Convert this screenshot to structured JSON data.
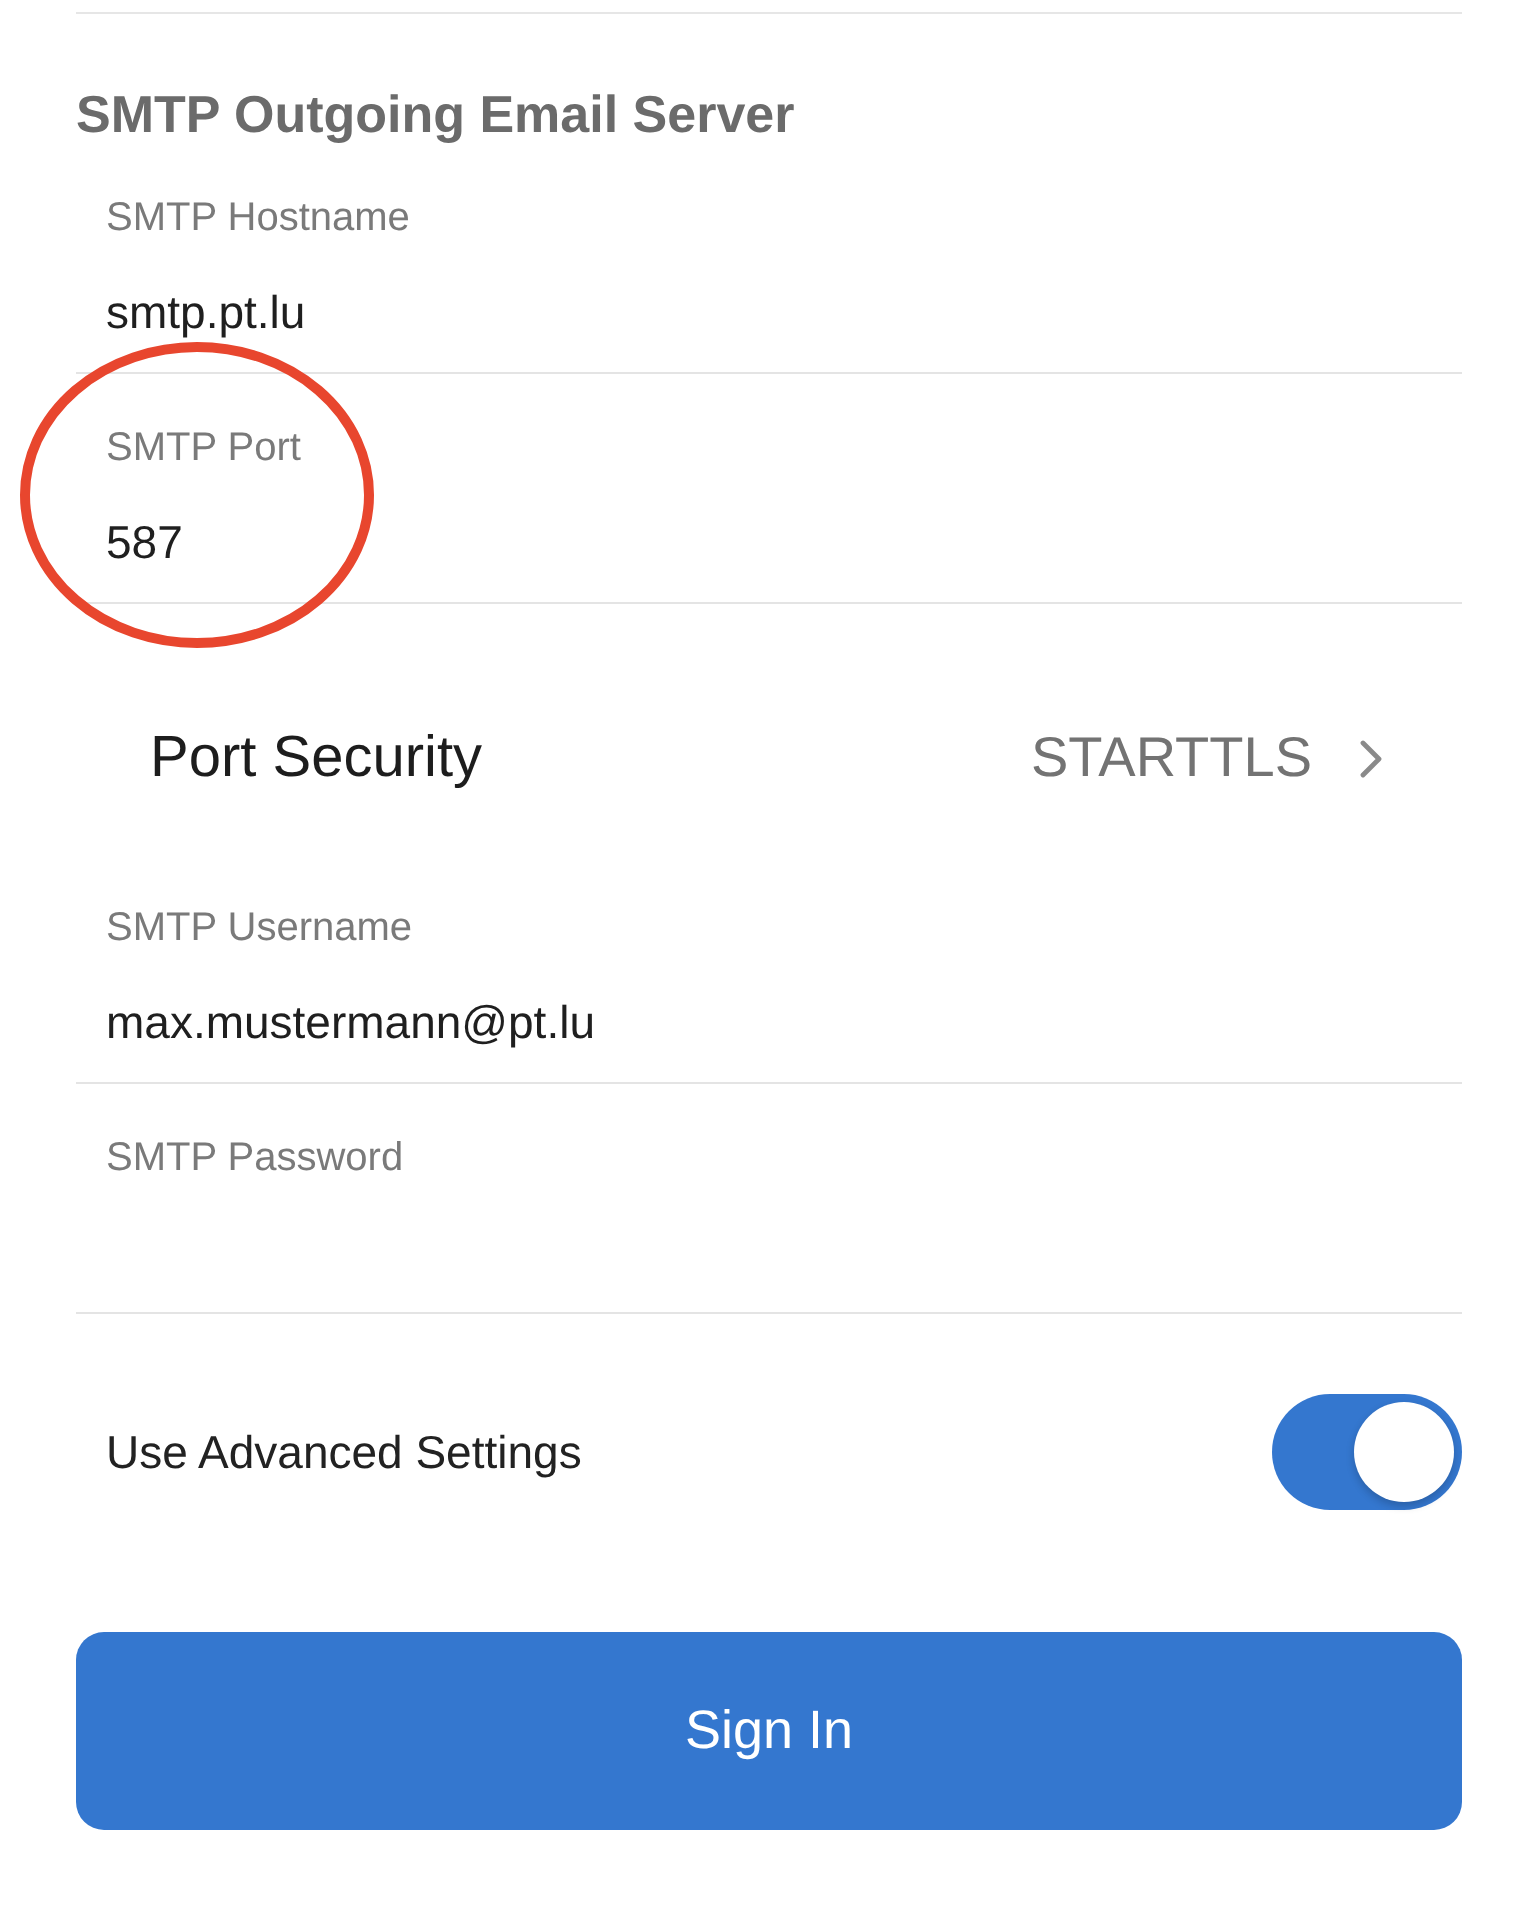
{
  "section": {
    "title": "SMTP Outgoing Email Server"
  },
  "rows": [
    {
      "kind": "field",
      "label": "SMTP Hostname",
      "value": "smtp.pt.lu",
      "circled": false
    },
    {
      "kind": "field",
      "label": "SMTP Port",
      "value": "587",
      "circled": true
    },
    {
      "kind": "picker",
      "label": "Port Security",
      "value": "STARTTLS",
      "circled": false
    },
    {
      "kind": "field",
      "label": "SMTP Username",
      "value": "max.mustermann@pt.lu",
      "circled": false
    },
    {
      "kind": "password",
      "label": "SMTP Password",
      "circled": false
    },
    {
      "kind": "toggle",
      "label": "Use Advanced Settings",
      "on": true,
      "circled": false
    }
  ],
  "button": {
    "label": "Sign In"
  }
}
